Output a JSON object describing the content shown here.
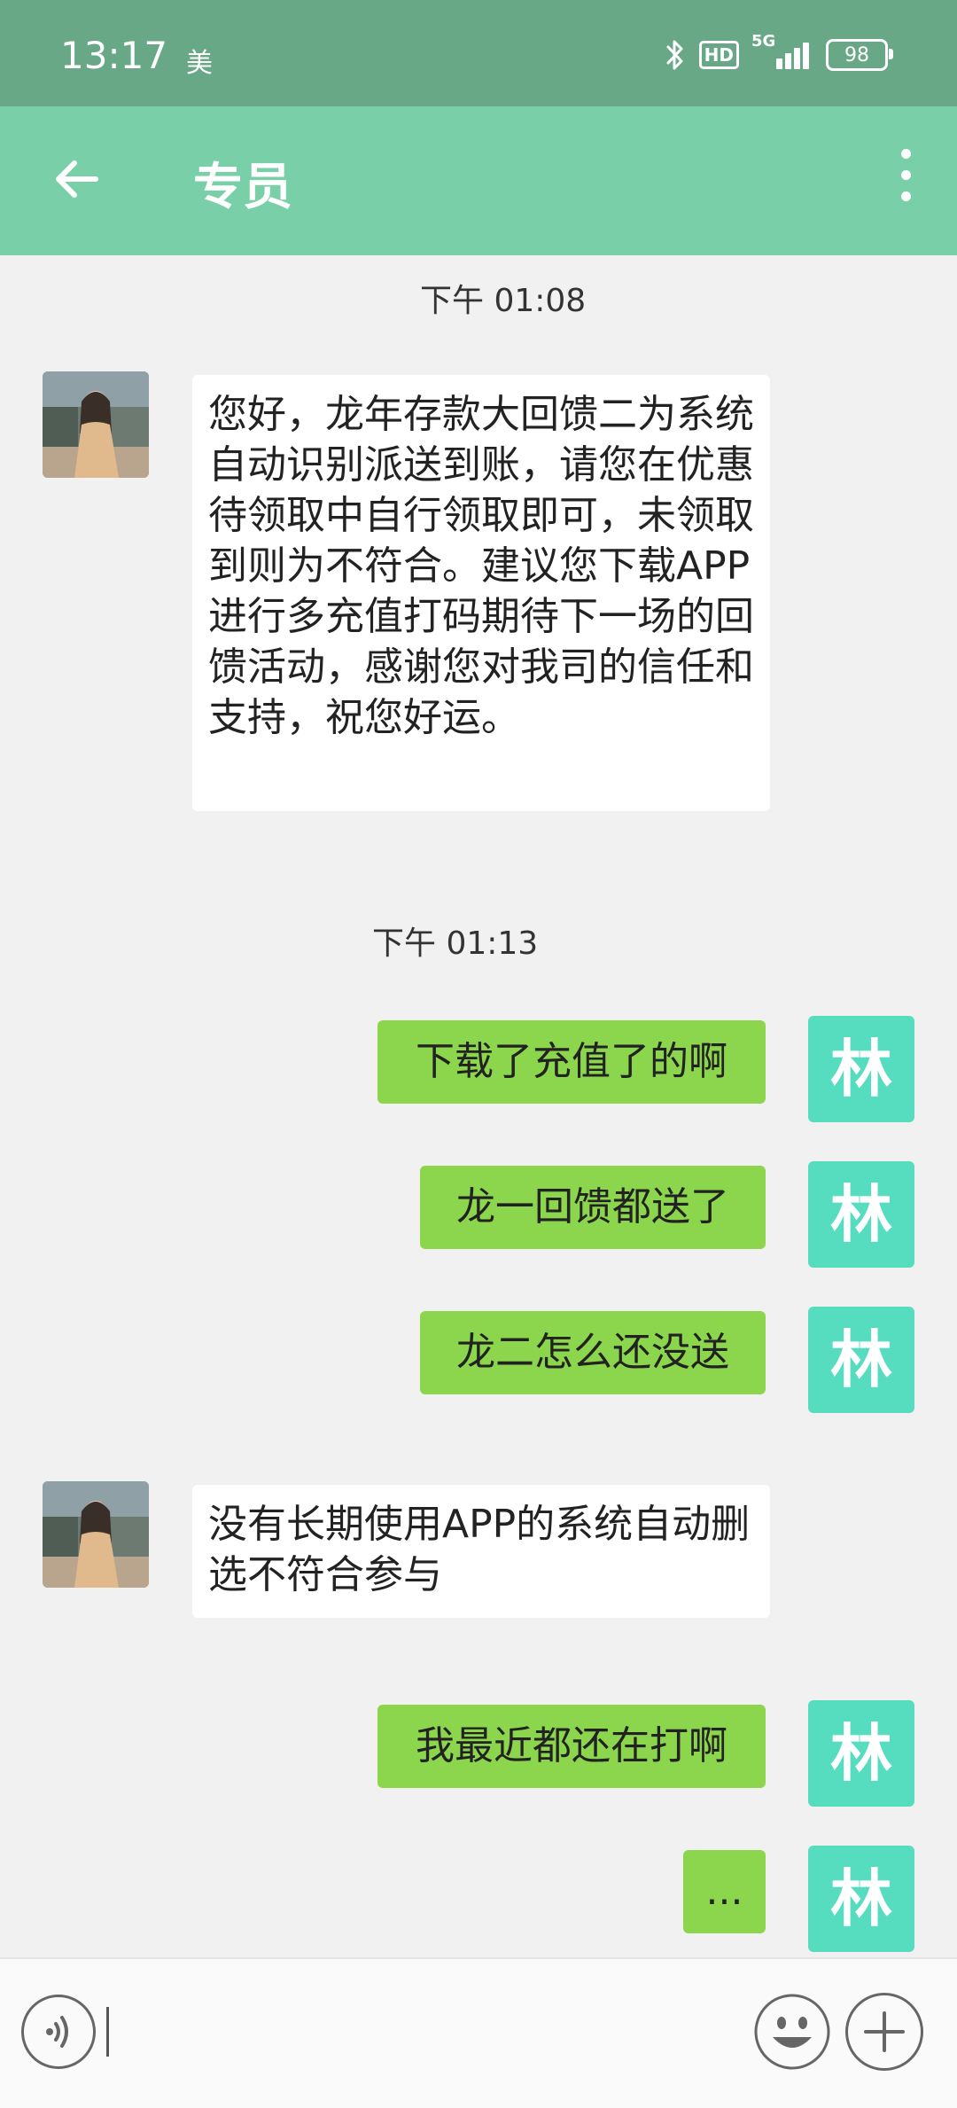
{
  "status_bar": {
    "time": "13:17",
    "carrier": "美",
    "hd_label": "HD",
    "network": "5G",
    "battery": "98"
  },
  "app_bar": {
    "title": "专员"
  },
  "messages": [
    {
      "type": "timestamp",
      "text": "下午 01:08"
    },
    {
      "type": "incoming",
      "text": "您好，龙年存款大回馈二为系统自动识别派送到账，请您在优惠待领取中自行领取即可，未领取到则为不符合。建议您下载APP进行多充值打码期待下一场的回馈活动，感谢您对我司的信任和支持，祝您好运。"
    },
    {
      "type": "timestamp",
      "text": "下午 01:13"
    },
    {
      "type": "outgoing",
      "text": "下载了充值了的啊",
      "avatar": "林"
    },
    {
      "type": "outgoing",
      "text": "龙一回馈都送了",
      "avatar": "林"
    },
    {
      "type": "outgoing",
      "text": "龙二怎么还没送",
      "avatar": "林"
    },
    {
      "type": "incoming",
      "text": "没有长期使用APP的系统自动删选不符合参与"
    },
    {
      "type": "outgoing",
      "text": "我最近都还在打啊",
      "avatar": "林"
    },
    {
      "type": "outgoing",
      "text": "...",
      "avatar": "林"
    }
  ],
  "input": {
    "value": "",
    "placeholder": ""
  },
  "colors": {
    "status_bar": "#69a887",
    "app_bar": "#79cfa7",
    "outgoing_bubble": "#8bd64d",
    "user_avatar": "#56dcbf",
    "background": "#f1f1f1"
  },
  "icons": [
    "back-arrow-icon",
    "more-vert-icon",
    "voice-icon",
    "emoji-icon",
    "plus-icon",
    "bluetooth-icon",
    "signal-icon",
    "battery-icon"
  ]
}
